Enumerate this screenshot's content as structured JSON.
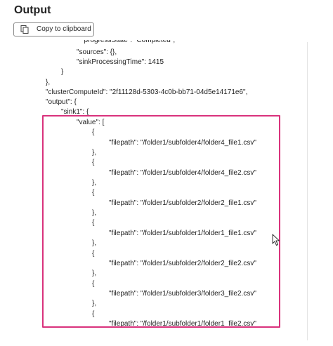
{
  "panel": {
    "title": "Output",
    "copy_label": "Copy to clipboard",
    "copy_icon": "copy-icon"
  },
  "code_lines": [
    "\"progressState\": \"Completed\",",
    "\"sources\": {},",
    "\"sinkProcessingTime\": 1415",
    "}",
    "},",
    "\"clusterComputeId\": \"2f11128d-5303-4c0b-bb71-04d5e14171e6\",",
    "\"output\": {",
    "\"sink1\": {",
    "\"value\": [",
    "{",
    "\"filepath\": \"/folder1/subfolder4/folder4_file1.csv\"",
    "},",
    "{",
    "\"filepath\": \"/folder1/subfolder4/folder4_file2.csv\"",
    "},",
    "{",
    "\"filepath\": \"/folder1/subfolder2/folder2_file1.csv\"",
    "},",
    "{",
    "\"filepath\": \"/folder1/subfolder1/folder1_file1.csv\"",
    "},",
    "{",
    "\"filepath\": \"/folder1/subfolder2/folder2_file2.csv\"",
    "},",
    "{",
    "\"filepath\": \"/folder1/subfolder3/folder3_file2.csv\"",
    "},",
    "{",
    "\"filepath\": \"/folder1/subfolder1/folder1_file2.csv\""
  ],
  "colors": {
    "highlight_border": "#d9327c",
    "text": "#1f1f1f"
  }
}
